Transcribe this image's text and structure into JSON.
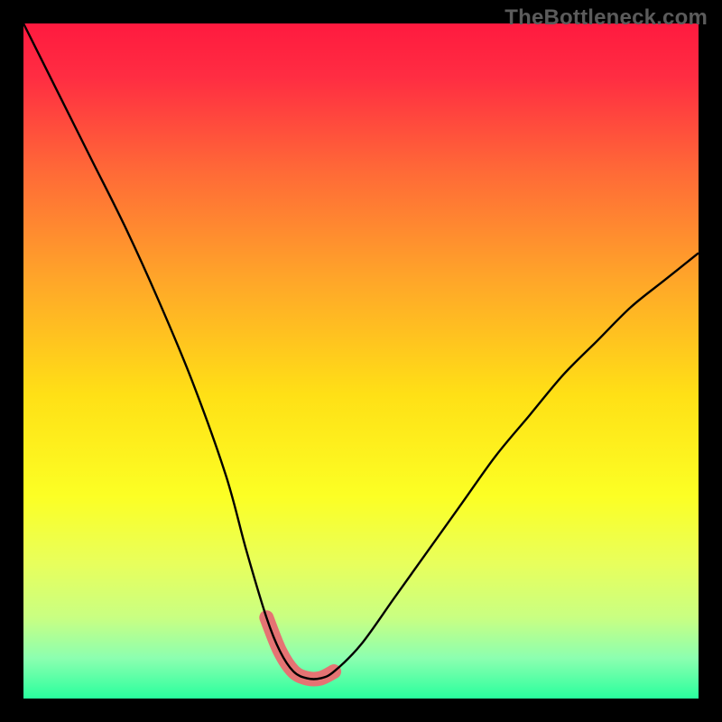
{
  "watermark": "TheBottleneck.com",
  "chart_data": {
    "type": "line",
    "title": "",
    "xlabel": "",
    "ylabel": "",
    "xlim": [
      0,
      100
    ],
    "ylim": [
      0,
      100
    ],
    "series": [
      {
        "name": "bottleneck-curve",
        "x": [
          0,
          5,
          10,
          15,
          20,
          25,
          30,
          33,
          36,
          38,
          40,
          42,
          44,
          46,
          50,
          55,
          60,
          65,
          70,
          75,
          80,
          85,
          90,
          95,
          100
        ],
        "values": [
          100,
          90,
          80,
          70,
          59,
          47,
          33,
          22,
          12,
          7,
          4,
          3,
          3,
          4,
          8,
          15,
          22,
          29,
          36,
          42,
          48,
          53,
          58,
          62,
          66
        ]
      },
      {
        "name": "optimal-range-highlight",
        "x": [
          36,
          38,
          40,
          42,
          44,
          46
        ],
        "values": [
          12,
          7,
          4,
          3,
          3,
          4
        ]
      }
    ],
    "gradient_stops": [
      {
        "pos": 0.0,
        "color": "#ff1a3f"
      },
      {
        "pos": 0.08,
        "color": "#ff2d42"
      },
      {
        "pos": 0.22,
        "color": "#ff6a37"
      },
      {
        "pos": 0.38,
        "color": "#ffa629"
      },
      {
        "pos": 0.55,
        "color": "#ffe016"
      },
      {
        "pos": 0.7,
        "color": "#fcff24"
      },
      {
        "pos": 0.8,
        "color": "#e8ff5c"
      },
      {
        "pos": 0.88,
        "color": "#c9ff82"
      },
      {
        "pos": 0.94,
        "color": "#8cffb0"
      },
      {
        "pos": 1.0,
        "color": "#29ff9d"
      }
    ],
    "curve_style": {
      "stroke": "#000000",
      "stroke_width": 2.4
    },
    "highlight_style": {
      "stroke": "#e57373",
      "stroke_width": 16,
      "linecap": "round"
    }
  }
}
